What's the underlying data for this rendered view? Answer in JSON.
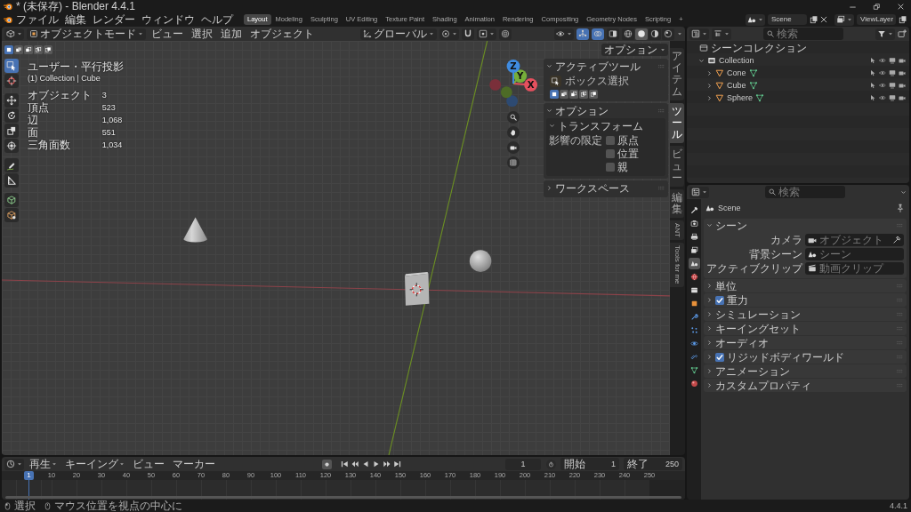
{
  "title_bar": {
    "title": "* (未保存) - Blender 4.4.1"
  },
  "menu_bar": {
    "menus": [
      "ファイル",
      "編集",
      "レンダー",
      "ウィンドウ",
      "ヘルプ"
    ],
    "workspaces": [
      {
        "label": "Layout",
        "selected": true
      },
      {
        "label": "Modeling",
        "selected": false
      },
      {
        "label": "Sculpting",
        "selected": false
      },
      {
        "label": "UV Editing",
        "selected": false
      },
      {
        "label": "Texture Paint",
        "selected": false
      },
      {
        "label": "Shading",
        "selected": false
      },
      {
        "label": "Animation",
        "selected": false
      },
      {
        "label": "Rendering",
        "selected": false
      },
      {
        "label": "Compositing",
        "selected": false
      },
      {
        "label": "Geometry Nodes",
        "selected": false
      },
      {
        "label": "Scripting",
        "selected": false
      }
    ],
    "add_workspace": "+",
    "scene": "Scene",
    "view_layer": "ViewLayer"
  },
  "viewport": {
    "header": {
      "mode": "オブジェクトモード",
      "menus": [
        "ビュー",
        "選択",
        "追加",
        "オブジェクト"
      ],
      "orientation": "グローバル",
      "toggles": [
        {
          "on": true
        },
        {
          "on": true
        },
        {
          "on": false
        }
      ],
      "shading": [
        {
          "selected": false
        },
        {
          "selected": true
        },
        {
          "selected": false
        },
        {
          "selected": false
        }
      ]
    },
    "tool_settings": {
      "modes": [
        {
          "selected": true
        },
        {
          "selected": false
        },
        {
          "selected": false
        },
        {
          "selected": false
        },
        {
          "selected": false
        }
      ],
      "options": "オプション"
    },
    "tools": [
      {
        "selected": true
      },
      {
        "selected": false
      },
      {
        "selected": false
      },
      {
        "selected": false
      },
      {
        "selected": false
      },
      {
        "selected": false
      },
      {
        "selected": false
      },
      {
        "selected": false
      },
      {
        "selected": false
      },
      {
        "selected": false
      }
    ],
    "overlay": {
      "view": "ユーザー・平行投影",
      "context": "(1) Collection | Cube",
      "stats": [
        {
          "label": "オブジェクト",
          "value": "3"
        },
        {
          "label": "頂点",
          "value": "523"
        },
        {
          "label": "辺",
          "value": "1,068"
        },
        {
          "label": "面",
          "value": "551"
        },
        {
          "label": "三角面数",
          "value": "1,034"
        }
      ]
    },
    "gizmo": [
      {
        "label": "X"
      },
      {
        "label": "Y"
      },
      {
        "label": "Z"
      }
    ],
    "sidebar": {
      "tabs": [
        {
          "label": "アイテム",
          "kind": "stacked",
          "selected": false
        },
        {
          "label": "ツール",
          "kind": "stacked",
          "selected": true
        },
        {
          "label": "ビュー",
          "kind": "stacked",
          "selected": false
        },
        {
          "label": "編集",
          "kind": "stacked",
          "selected": false
        },
        {
          "label": "ANT",
          "kind": "rotated",
          "selected": false
        },
        {
          "label": "Tools for me",
          "kind": "rotated",
          "selected": false
        }
      ],
      "active_tool": {
        "title": "アクティブツール",
        "expanded": true,
        "tool": "ボックス選択",
        "modes": [
          {
            "selected": true
          },
          {
            "selected": false
          },
          {
            "selected": false
          },
          {
            "selected": false
          },
          {
            "selected": false
          }
        ]
      },
      "options": {
        "title": "オプション",
        "expanded": true,
        "transform": {
          "title": "トランスフォーム",
          "expanded": true,
          "label": "影響の限定",
          "checks": [
            {
              "label": "原点",
              "checked": false
            },
            {
              "label": "位置",
              "checked": false
            },
            {
              "label": "親",
              "checked": false
            }
          ]
        }
      },
      "workspace": {
        "title": "ワークスペース",
        "expanded": false
      }
    }
  },
  "outliner": {
    "search": {
      "placeholder": "検索"
    },
    "tree": [
      {
        "label": "シーンコレクション",
        "kind": "scene",
        "children": [
          {
            "label": "Collection",
            "kind": "collection",
            "expanded": true,
            "children": [
              {
                "label": "Cone",
                "kind": "object",
                "expanded": false
              },
              {
                "label": "Cube",
                "kind": "object",
                "expanded": false
              },
              {
                "label": "Sphere",
                "kind": "object",
                "expanded": false
              }
            ]
          }
        ]
      }
    ]
  },
  "properties": {
    "search": {
      "placeholder": "検索"
    },
    "tabs": [
      {
        "selected": false
      },
      {
        "selected": false
      },
      {
        "selected": false
      },
      {
        "selected": false
      },
      {
        "selected": true
      },
      {
        "selected": false
      },
      {
        "selected": false
      },
      {
        "selected": false
      },
      {
        "selected": false
      },
      {
        "selected": false
      },
      {
        "selected": false
      },
      {
        "selected": false
      },
      {
        "selected": false
      },
      {
        "selected": false
      }
    ],
    "context": "Scene",
    "panels": [
      {
        "title": "シーン",
        "kind": "plain",
        "expanded": true,
        "fields": [
          {
            "label": "カメラ",
            "placeholder": "オブジェクト",
            "eyedropper": true
          },
          {
            "label": "背景シーン",
            "placeholder": "シーン",
            "eyedropper": false
          },
          {
            "label": "アクティブクリップ",
            "placeholder": "動画クリップ",
            "eyedropper": false
          }
        ]
      },
      {
        "title": "単位",
        "kind": "plain",
        "expanded": false
      },
      {
        "title": "重力",
        "kind": "toggle",
        "checked": true,
        "expanded": false
      },
      {
        "title": "シミュレーション",
        "kind": "plain",
        "expanded": false
      },
      {
        "title": "キーイングセット",
        "kind": "plain",
        "expanded": false
      },
      {
        "title": "オーディオ",
        "kind": "plain",
        "expanded": false
      },
      {
        "title": "リジッドボディワールド",
        "kind": "toggle",
        "checked": true,
        "expanded": false
      },
      {
        "title": "アニメーション",
        "kind": "plain",
        "expanded": false
      },
      {
        "title": "カスタムプロパティ",
        "kind": "plain",
        "expanded": false
      }
    ]
  },
  "timeline": {
    "menus": [
      {
        "label": "再生",
        "dropdown": true
      },
      {
        "label": "キーイング",
        "dropdown": true
      },
      {
        "label": "ビュー",
        "dropdown": false
      },
      {
        "label": "マーカー",
        "dropdown": false
      }
    ],
    "current_frame": "1",
    "start": {
      "label": "開始",
      "value": "1"
    },
    "end": {
      "label": "終了",
      "value": "250"
    },
    "playhead": "1",
    "ticks": [
      "10",
      "20",
      "30",
      "40",
      "50",
      "60",
      "70",
      "80",
      "90",
      "100",
      "110",
      "120",
      "130",
      "140",
      "150",
      "160",
      "170",
      "180",
      "190",
      "200",
      "210",
      "220",
      "230",
      "240",
      "250"
    ]
  },
  "status_bar": {
    "hints": [
      "選択",
      "マウス位置を視点の中心に"
    ],
    "version": "4.4.1"
  }
}
